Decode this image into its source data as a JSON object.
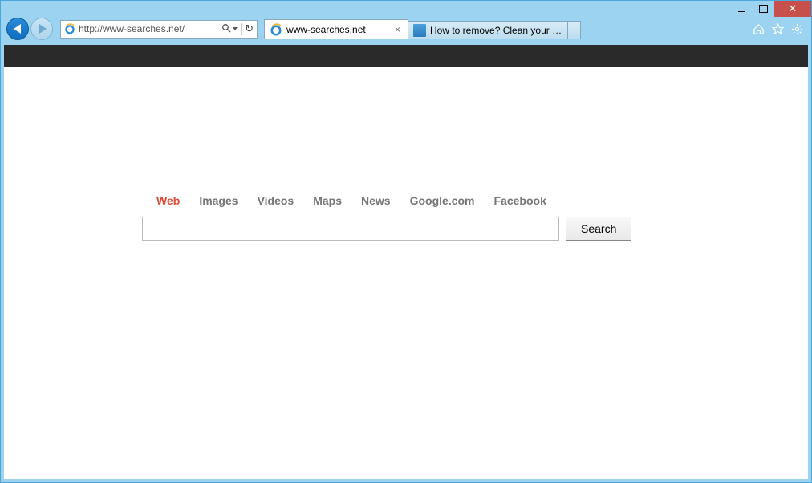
{
  "window": {
    "min_tooltip": "Minimize",
    "max_tooltip": "Maximize",
    "close_tooltip": "Close",
    "close_glyph": "✕"
  },
  "toolbar": {
    "url": "http://www-searches.net/",
    "search_placeholder": "",
    "home_tooltip": "Home",
    "fav_tooltip": "Favorites",
    "tools_tooltip": "Tools"
  },
  "tabs": [
    {
      "title": "www-searches.net",
      "active": true,
      "favicon": "ie"
    },
    {
      "title": "How to remove? Clean your co...",
      "active": false,
      "favicon": "trash"
    }
  ],
  "page": {
    "categories": [
      {
        "label": "Web",
        "active": true
      },
      {
        "label": "Images",
        "active": false
      },
      {
        "label": "Videos",
        "active": false
      },
      {
        "label": "Maps",
        "active": false
      },
      {
        "label": "News",
        "active": false
      },
      {
        "label": "Google.com",
        "active": false
      },
      {
        "label": "Facebook",
        "active": false
      }
    ],
    "search_value": "",
    "search_button": "Search"
  }
}
